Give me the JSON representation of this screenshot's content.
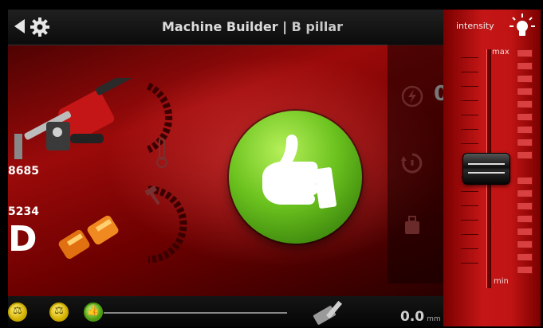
{
  "header": {
    "title": "Machine Builder |",
    "subtitle": "B pillar"
  },
  "icons": {
    "back": "back-arrow-icon",
    "settings": "gear-icon",
    "lightning": "lightning-icon",
    "timer": "timer-icon",
    "weight": "weight-icon",
    "thermometer": "thermometer-icon",
    "hammer": "hammer-icon",
    "brightness": "lightbulb-icon",
    "pen": "pen-icon",
    "thumbs_up": "thumbs-up-icon"
  },
  "left_panel": {
    "counter_top": "8685",
    "counter_bottom": "5234",
    "grade": "D"
  },
  "right_panel": {
    "gauge_value": "0"
  },
  "status_bar": {
    "coins": [
      "balance-coin",
      "balance-coin",
      "thumbs-up-coin"
    ],
    "distance_value": "0.0",
    "distance_unit": "mm"
  },
  "intensity_panel": {
    "label": "intensity",
    "max_label": "max",
    "min_label": "min",
    "level_fraction": 0.52
  },
  "colors": {
    "background_red": "#9b0a0a",
    "ok_green": "#6bc21e",
    "panel_red": "#c41616"
  }
}
